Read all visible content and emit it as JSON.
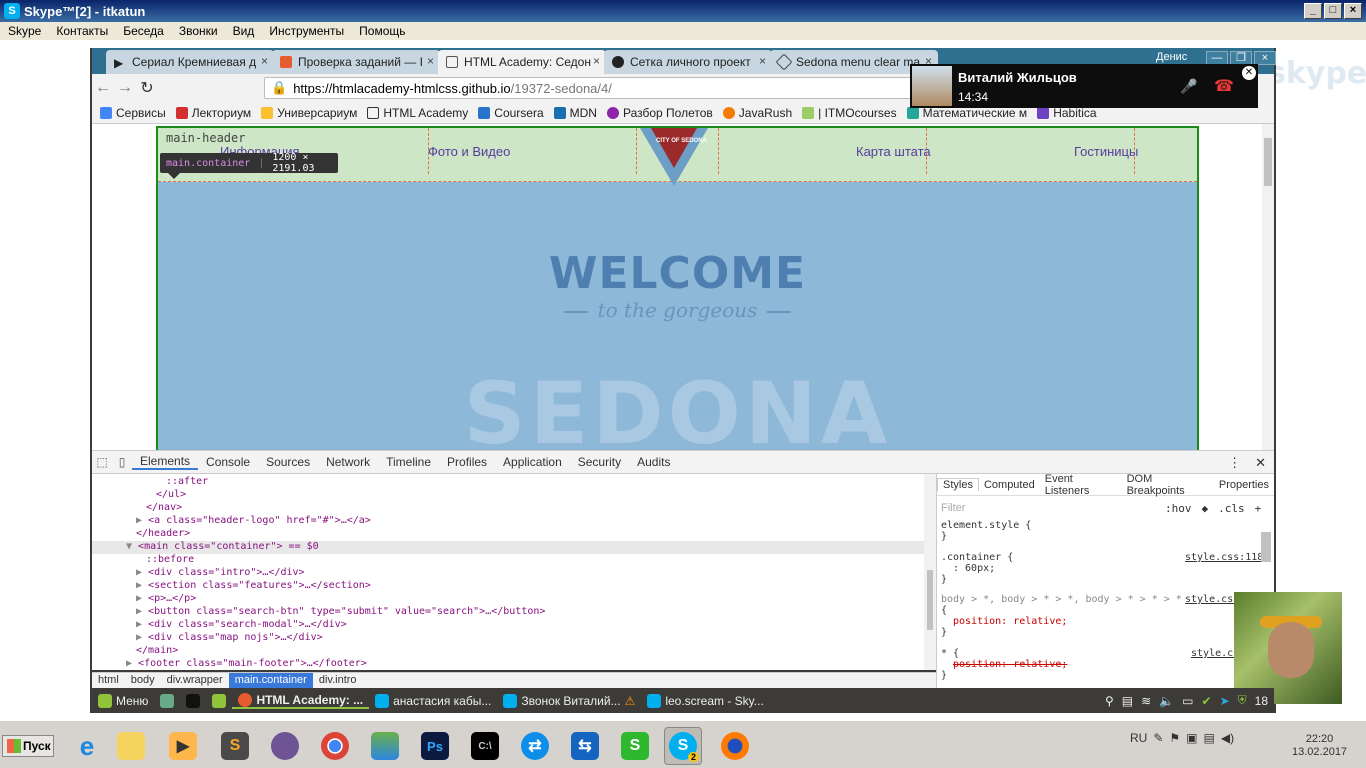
{
  "skype": {
    "title": "Skype™[2] - itkatun",
    "menu": [
      "Skype",
      "Контакты",
      "Беседа",
      "Звонки",
      "Вид",
      "Инструменты",
      "Помощь"
    ],
    "logo": "skype"
  },
  "chrome": {
    "tabs": [
      {
        "label": "Сериал Кремниевая д",
        "color": "#222222"
      },
      {
        "label": "Проверка заданий — I",
        "color": "#e65c2f"
      },
      {
        "label": "HTML Academy: Седон",
        "color": "#555555"
      },
      {
        "label": "Сетка личного проект",
        "color": "#222222"
      },
      {
        "label": "Sedona menu clear ma",
        "color": "#444444"
      }
    ],
    "profile": "Денис",
    "url_host": "https://htmlacademy-htmlcss.github.io",
    "url_path": "/19372-sedona/4/",
    "bookmarks": [
      "Сервисы",
      "Лекториум",
      "Универсариум",
      "HTML Academy",
      "Coursera",
      "MDN",
      "Разбор Полетов",
      "JavaRush",
      "| ITMOcourses",
      "Математические м",
      "Habitica"
    ]
  },
  "page": {
    "header_label": "main-header",
    "nav": [
      "Информация",
      "Фото и Видео",
      "Карта штата",
      "Гостиницы"
    ],
    "logo_text": "CITY OF SEDONA",
    "tooltip_tag": "main",
    "tooltip_class": ".container",
    "tooltip_size": "1200 × 2191.03",
    "welcome": "WELCOME",
    "gorgeous": "to the gorgeous",
    "sedona": "SEDONA"
  },
  "call": {
    "name": "Виталий Жильцов",
    "time": "14:34"
  },
  "devtools": {
    "tabs": [
      "Elements",
      "Console",
      "Sources",
      "Network",
      "Timeline",
      "Profiles",
      "Application",
      "Security",
      "Audits"
    ],
    "active_tab": "Elements",
    "dom": [
      "::after",
      "</ul>",
      "</nav>",
      "<a class=\"header-logo\" href=\"#\">…</a>",
      "</header>",
      "<main class=\"container\"> == $0",
      "::before",
      "<div class=\"intro\">…</div>",
      "<section class=\"features\">…</section>",
      "<p>…</p>",
      "<button class=\"search-btn\" type=\"submit\" value=\"search\">…</button>",
      "<div class=\"search-modal\">…</div>",
      "<div class=\"map nojs\">…</div>",
      "</main>",
      "<footer class=\"main-footer\">…</footer>"
    ],
    "breadcrumbs": [
      "html",
      "body",
      "div.wrapper",
      "main.container",
      "div.intro"
    ],
    "active_crumb": "main.container",
    "styles_tabs": [
      "Styles",
      "Computed",
      "Event Listeners",
      "DOM Breakpoints",
      "Properties"
    ],
    "filter_placeholder": "Filter",
    "hov": ":hov",
    "cls": ".cls",
    "rules": {
      "element_style": "element.style {",
      "container_sel": ".container {",
      "container_src": "style.css:118",
      "container_prop": ": 60px;",
      "body_sel": "body > *, body > * > *, body > * > * > *",
      "body_src": "style.css",
      "body_prop": "position: relative;",
      "star_sel": "* {",
      "star_src": "style.cs",
      "star_prop": "position: relative;",
      "open": "{",
      "close": "}"
    }
  },
  "linux_panel": {
    "menu": "Меню",
    "windows": [
      "HTML Academy: ...",
      "анастасия кабы...",
      "Звонок Виталий...",
      "leo.scream - Sky..."
    ],
    "tray_num": "18"
  },
  "windows": {
    "start": "Пуск",
    "lang": "RU",
    "time": "22:20",
    "date": "13.02.2017",
    "skype_badge": "2"
  }
}
